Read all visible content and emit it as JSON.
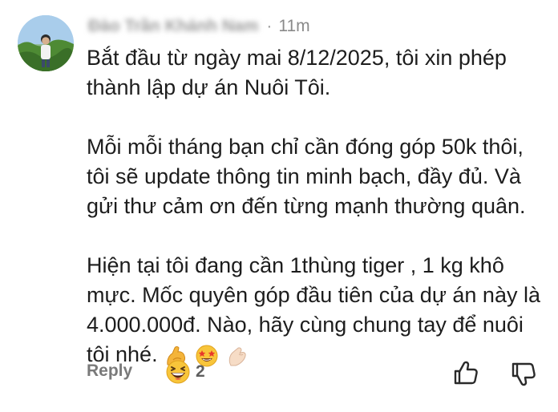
{
  "comment": {
    "author": "Đào Trần Khánh Nam",
    "separator": "·",
    "time": "11m",
    "paragraphs": [
      "Bắt đầu từ ngày mai 8/12/2025, tôi xin phép thành lập dự án Nuôi Tôi.",
      "Mỗi mỗi tháng bạn chỉ cần đóng góp 50k thôi, tôi sẽ update thông tin minh bạch, đầy đủ. Và gửi thư cảm ơn đến từng mạnh thường quân.",
      "Hiện tại tôi đang cần 1thùng tiger , 1 kg khô mực. Mốc quyên góp đầu tiên của dự án này là 4.000.000đ. Nào, hãy cùng chung tay để nuôi tôi nhé."
    ],
    "trailing_emojis": [
      "flexed-biceps",
      "star-struck",
      "pinching-hand"
    ]
  },
  "actions": {
    "reply_label": "Reply",
    "reaction_emoji": "grinning-squinting-face",
    "reaction_count": "2",
    "like_icon": "thumbs-up-icon",
    "dislike_icon": "thumbs-down-icon"
  },
  "colors": {
    "text": "#1d1d1d",
    "meta": "#8a8a8a",
    "reply": "#7a7a7a"
  }
}
